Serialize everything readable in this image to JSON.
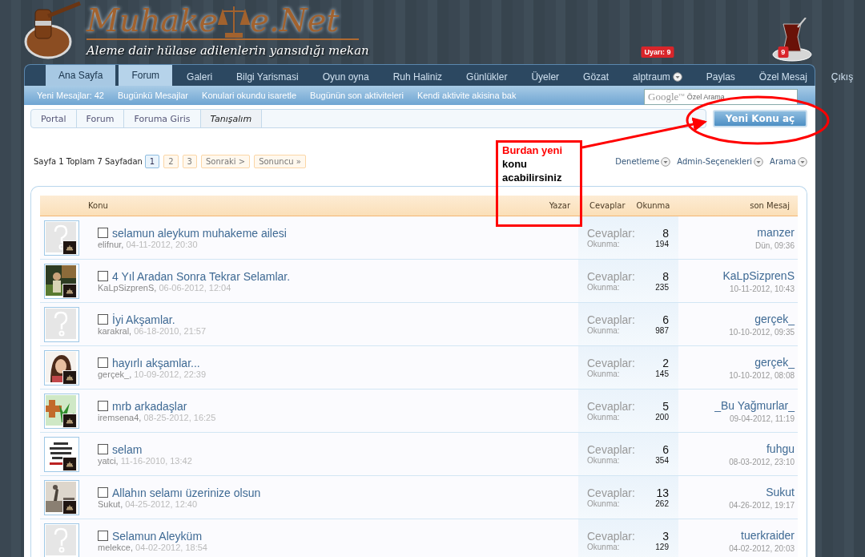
{
  "header": {
    "logo_start": "Muhake",
    "logo_end": "e.Net",
    "tagline": "Aleme dair hülase adilenlerin yansıdığı mekan"
  },
  "nav": [
    {
      "label": "Ana Sayfa",
      "selected": false,
      "highlighted": true
    },
    {
      "label": "Forum",
      "selected": true,
      "highlighted": false
    },
    {
      "label": "Galeri",
      "selected": false,
      "highlighted": false
    },
    {
      "label": "Bilgi Yarismasi",
      "selected": false,
      "highlighted": false
    },
    {
      "label": "Oyun oyna",
      "selected": false,
      "highlighted": false
    },
    {
      "label": "Ruh Haliniz",
      "selected": false,
      "highlighted": false
    },
    {
      "label": "Günlükler",
      "selected": false,
      "highlighted": false
    },
    {
      "label": "Üyeler",
      "selected": false,
      "highlighted": false
    },
    {
      "label": "Gözat",
      "selected": false,
      "highlighted": false
    },
    {
      "label": "alptraum",
      "selected": false,
      "highlighted": false,
      "badge": "Uyarı: 9",
      "dropdown": true
    },
    {
      "label": "Paylas",
      "selected": false,
      "highlighted": false
    },
    {
      "label": "Özel Mesaj",
      "selected": false,
      "highlighted": false,
      "badge": "9"
    },
    {
      "label": "Çıkış",
      "selected": false,
      "highlighted": false
    }
  ],
  "subnav": [
    "Yeni Mesajlar: 42",
    "Bugünkü Mesajlar",
    "Konulari okundu isaretle",
    "Bugünün son aktiviteleri",
    "Kendi aktivite akisina bak"
  ],
  "search": {
    "logo": "Google$^{TM}$",
    "placeholder": "Özel Arama"
  },
  "breadcrumb": [
    {
      "label": "Portal",
      "current": false
    },
    {
      "label": "Forum",
      "current": false
    },
    {
      "label": "Foruma Giris",
      "current": false
    },
    {
      "label": "Tanışalım",
      "current": true
    }
  ],
  "new_topic_button": "Yeni Konu aç",
  "pagination": {
    "summary": "Sayfa 1 Toplam 7 Sayfadan",
    "pages": [
      {
        "label": "1",
        "selected": true
      },
      {
        "label": "2",
        "selected": false
      },
      {
        "label": "3",
        "selected": false
      },
      {
        "label": "Sonraki >",
        "selected": false
      },
      {
        "label": "Sonuncu »",
        "selected": false
      }
    ]
  },
  "tools": [
    "Denetleme",
    "Admin-Seçenekleri",
    "Arama"
  ],
  "annotation": {
    "title": "Burdan yeni",
    "text": "konu acabilirsiniz"
  },
  "table": {
    "columns": [
      "Konu",
      "Yazar",
      "Cevaplar",
      "Okunma",
      "son Mesaj"
    ],
    "rows": [
      {
        "avatar": {
          "kind": "placeholder"
        },
        "badge": true,
        "checked": false,
        "title": "selamun aleykum muhakeme ailesi",
        "author": "elifnur,",
        "date": "04-11-2012, 20:30",
        "replies_label": "Cevaplar:",
        "replies": "8",
        "views_label": "Okunma:",
        "views": "194",
        "last_user": "manzer",
        "last_time": "Dün, 09:36"
      },
      {
        "badge": true,
        "checked": false,
        "title": "4 Yıl Aradan Sonra Tekrar Selamlar.",
        "author": "KaLpSizprenS,",
        "date": "06-06-2012, 12:04",
        "replies_label": "Cevaplar:",
        "replies": "8",
        "views_label": "Okunma:",
        "views": "235",
        "last_user": "KaLpSizprenS",
        "last_time": "10-11-2012, 10:43"
      },
      {
        "avatar": {
          "kind": "placeholder"
        },
        "badge": false,
        "checked": false,
        "title": "İyi Akşamlar.",
        "author": "karakral,",
        "date": "06-18-2010, 21:57",
        "replies_label": "Cevaplar:",
        "replies": "6",
        "views_label": "Okunma:",
        "views": "987",
        "last_user": "gerçek_",
        "last_time": "10-10-2012, 09:35"
      },
      {
        "badge": true,
        "checked": false,
        "title": "hayırlı akşamlar...",
        "author": "gerçek_,",
        "date": "10-09-2012, 22:39",
        "replies_label": "Cevaplar:",
        "replies": "2",
        "views_label": "Okunma:",
        "views": "145",
        "last_user": "gerçek_",
        "last_time": "10-10-2012, 08:08"
      },
      {
        "badge": true,
        "checked": false,
        "title": "mrb arkadaşlar",
        "author": "iremsena4,",
        "date": "08-25-2012, 16:25",
        "replies_label": "Cevaplar:",
        "replies": "5",
        "views_label": "Okunma:",
        "views": "200",
        "last_user": "_Bu Yağmurlar_",
        "last_time": "09-04-2012, 11:19"
      },
      {
        "badge": true,
        "checked": false,
        "title": "selam",
        "author": "yatci,",
        "date": "11-16-2010, 13:42",
        "replies_label": "Cevaplar:",
        "replies": "6",
        "views_label": "Okunma:",
        "views": "354",
        "last_user": "fuhgu",
        "last_time": "08-03-2012, 23:10"
      },
      {
        "badge": true,
        "checked": false,
        "title": "Allahın selamı üzerinize olsun",
        "author": "Sukut,",
        "date": "04-25-2012, 12:40",
        "replies_label": "Cevaplar:",
        "replies": "13",
        "views_label": "Okunma:",
        "views": "262",
        "last_user": "Sukut",
        "last_time": "04-26-2012, 19:17"
      },
      {
        "avatar": {
          "kind": "placeholder"
        },
        "badge": false,
        "checked": false,
        "title": "Selamun Aleyküm",
        "author": "melekce,",
        "date": "04-02-2012, 18:54",
        "replies_label": "Cevaplar:",
        "replies": "3",
        "views_label": "Okunma:",
        "views": "129",
        "last_user": "tuerkraider",
        "last_time": "04-02-2012, 20:03"
      }
    ]
  }
}
